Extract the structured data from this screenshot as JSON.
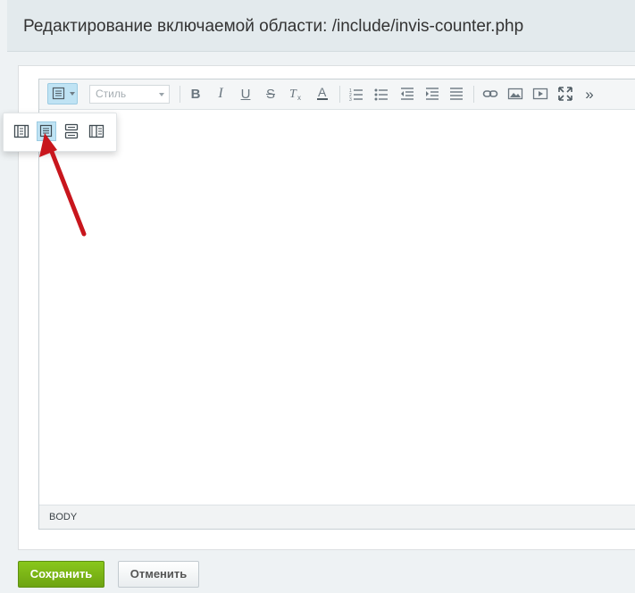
{
  "dialog": {
    "title": "Редактирование включаемой области: /include/invis-counter.php"
  },
  "toolbar": {
    "style_placeholder": "Стиль",
    "buttons": [
      "view-mode",
      "bold",
      "italic",
      "underline",
      "strikethrough",
      "remove-format",
      "text-color",
      "ordered-list",
      "unordered-list",
      "outdent",
      "indent",
      "align",
      "link",
      "image",
      "video",
      "fullscreen",
      "more"
    ]
  },
  "status": {
    "path": "BODY"
  },
  "view_modes": [
    "code",
    "visual",
    "split-horizontal",
    "split-vertical"
  ],
  "footer": {
    "save_label": "Сохранить",
    "cancel_label": "Отменить"
  },
  "colors": {
    "accent": "#7ab51d",
    "active_highlight": "#bfe3f4",
    "arrow": "#c8161d"
  }
}
